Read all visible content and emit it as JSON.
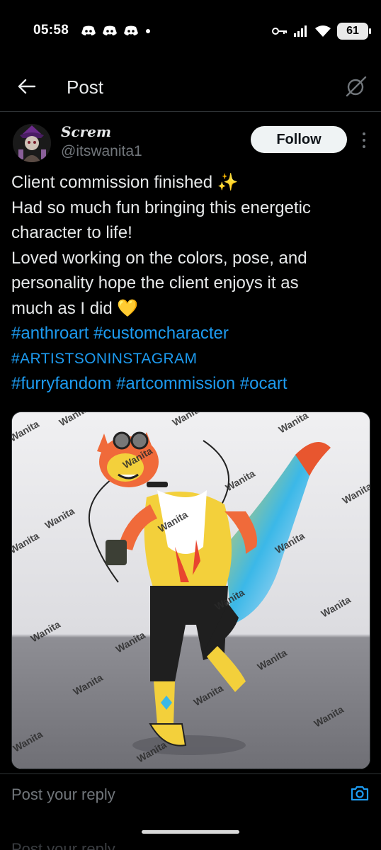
{
  "status_bar": {
    "time": "05:58",
    "battery": "61",
    "notification_icons": [
      "discord-icon",
      "discord-icon",
      "discord-icon",
      "dot-icon"
    ],
    "system_icons": [
      "key-icon",
      "signal-icon",
      "wifi-icon",
      "battery-icon"
    ]
  },
  "header": {
    "title": "Post"
  },
  "post": {
    "display_name": "Screm",
    "handle": "@itswanita1",
    "follow_label": "Follow",
    "lines": [
      "Client commission finished ✨",
      "Had so much fun bringing this energetic",
      "character to life!",
      "Loved working on the colors, pose, and",
      "personality hope the client enjoys it as",
      "much as I did 💛"
    ],
    "hashtags_line1": "#anthroart #customcharacter",
    "hashtags_line2": "#ARTISTSONINSTAGRAM",
    "hashtags_line3": "#furryfandom #artcommission #ocart",
    "watermark": "Wanita"
  },
  "reply": {
    "placeholder": "Post your reply",
    "ghost_text": "Post your reply"
  },
  "colors": {
    "background": "#000000",
    "text": "#e7e9ea",
    "muted": "#71767b",
    "link": "#1d9bf0",
    "follow_bg": "#eff3f4"
  }
}
